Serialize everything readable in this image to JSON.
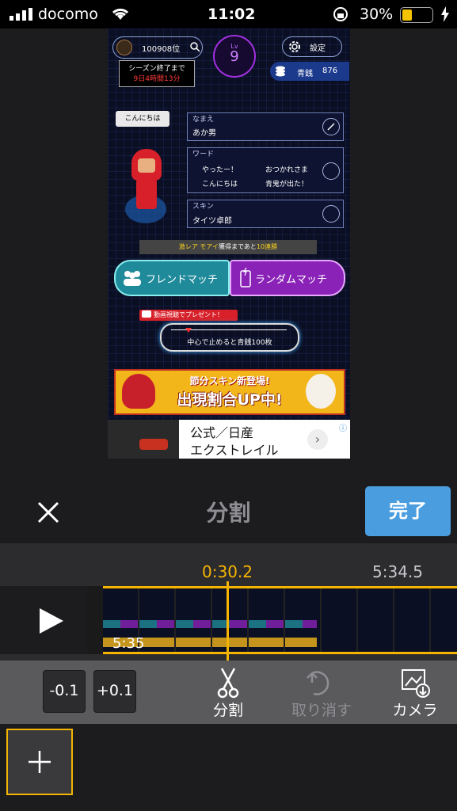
{
  "status_bar": {
    "carrier": "docomo",
    "time": "11:02",
    "battery": "30%"
  },
  "game": {
    "rank": "100908位",
    "season_end_label": "シーズン終了まで",
    "season_remaining": "9日4時間13分",
    "level_label": "Lv",
    "level": "9",
    "settings_label": "設定",
    "currency_label": "青銭",
    "currency_value": "876",
    "speech_bubble": "こんにちは",
    "name_label": "なまえ",
    "name_value": "あか男",
    "word_label": "ワード",
    "words": [
      "やったー！",
      "おつかれさま",
      "こんにちは",
      "青鬼が出た！"
    ],
    "skin_label": "スキン",
    "skin_value": "タイツ卓郎",
    "rare_banner_prefix": "激レア モアイ",
    "rare_banner_mid": "獲得まであと",
    "rare_banner_suffix": "10連勝",
    "friend_match": "フレンドマッチ",
    "random_match": "ランダムマッチ",
    "video_present": "動画視聴でプレゼント！",
    "roulette_text": "中心で止めると青銭100枚",
    "event_line1": "節分スキン新登場!",
    "event_line2": "出現割合UP中!",
    "ad_line1": "公式／日産",
    "ad_line2": "エクストレイル"
  },
  "editor": {
    "close_icon": "close-icon",
    "title": "分割",
    "done_label": "完了",
    "accent": "#f5b400",
    "done_color": "#4a9ee0"
  },
  "timeline": {
    "current_time": "0:30.2",
    "end_time": "5:34.5",
    "clip_duration": "5:35"
  },
  "toolbar": {
    "minus_label": "-0.1",
    "plus_label": "+0.1",
    "split_label": "分割",
    "undo_label": "取り消す",
    "camera_label": "カメラ"
  }
}
